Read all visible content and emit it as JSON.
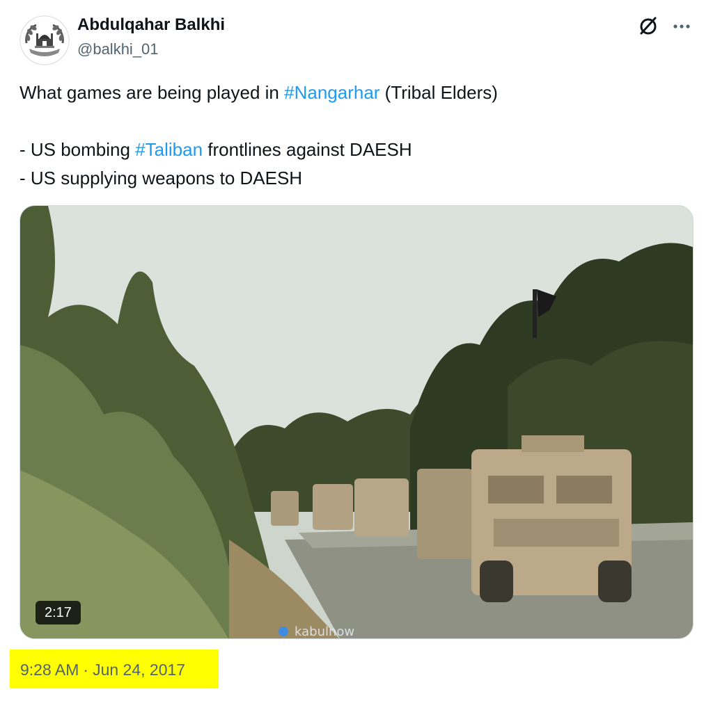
{
  "author": {
    "display_name": "Abdulqahar Balkhi",
    "handle": "@balkhi_01",
    "avatar_icon": "emblem-icon"
  },
  "actions": {
    "grok_icon": "grok-slash-circle-icon",
    "more_icon": "more-dots-icon"
  },
  "tweet": {
    "lines": [
      {
        "before": "What games are being played in ",
        "hashtag": "#Nangarhar",
        "after": " (Tribal Elders)"
      },
      {
        "text": ""
      },
      {
        "before": "- US bombing ",
        "hashtag": "#Taliban",
        "after": " frontlines against DAESH"
      },
      {
        "text": "- US supplying weapons to DAESH"
      }
    ]
  },
  "media": {
    "type": "video",
    "duration": "2:17",
    "watermark": "kabulnow"
  },
  "meta": {
    "time": "9:28 AM",
    "separator": "·",
    "date": "Jun 24, 2017",
    "highlight_color": "#ffff00"
  },
  "colors": {
    "text": "#0f1419",
    "secondary": "#536471",
    "link": "#1d9bf0"
  }
}
